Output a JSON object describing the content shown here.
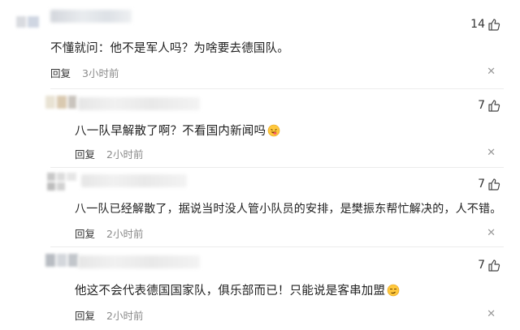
{
  "comments": [
    {
      "likes": "14",
      "text": "不懂就问：他不是军人吗？为啥要去德国队。",
      "reply_label": "回复",
      "time": "3小时前",
      "emoji": ""
    },
    {
      "likes": "7",
      "text": "八一队早解散了啊？不看国内新闻吗",
      "reply_label": "回复",
      "time": "2小时前",
      "emoji": "laughing-tongue-emoji"
    },
    {
      "likes": "7",
      "text": "八一队已经解散了，据说当时没人管小队员的安排，是樊振东帮忙解决的，人不错。",
      "reply_label": "回复",
      "time": "2小时前",
      "emoji": ""
    },
    {
      "likes": "7",
      "text": "他这不会代表德国国家队，俱乐部而已！只能说是客串加盟",
      "reply_label": "回复",
      "time": "2小时前",
      "emoji": "smirk-emoji"
    }
  ],
  "icons": {
    "like": "thumbs-up-icon",
    "close": "close-icon"
  },
  "colors": {
    "text": "#1f1f1f",
    "time": "#8a8a8a",
    "divider": "#ececec"
  }
}
